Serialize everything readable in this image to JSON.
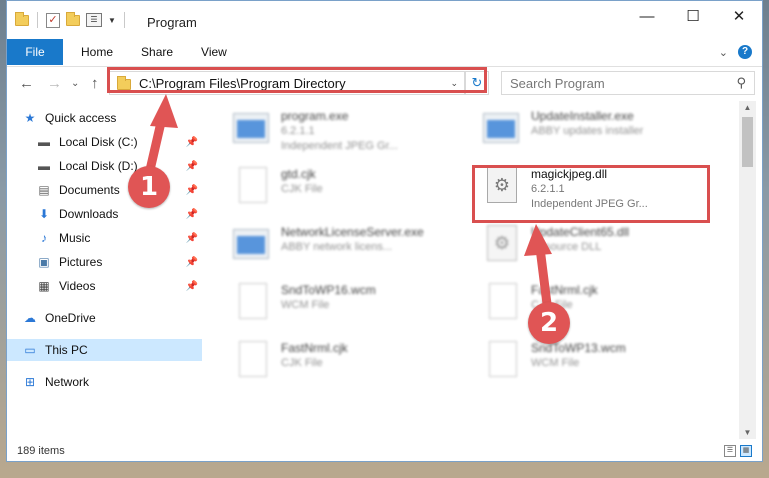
{
  "window": {
    "title": "Program",
    "controls": {
      "minimize": "—",
      "maximize": "☐",
      "close": "✕"
    }
  },
  "ribbon": {
    "file_tab": "File",
    "tabs": [
      "Home",
      "Share",
      "View"
    ]
  },
  "address": {
    "path": "C:\\Program Files\\Program Directory",
    "search_placeholder": "Search Program"
  },
  "sidebar": {
    "items": [
      {
        "label": "Quick access",
        "icon": "star-icon",
        "pinned": false
      },
      {
        "label": "Local Disk (C:)",
        "icon": "drive-icon",
        "pinned": true
      },
      {
        "label": "Local Disk (D:)",
        "icon": "drive-icon",
        "pinned": true
      },
      {
        "label": "Documents",
        "icon": "documents-icon",
        "pinned": true
      },
      {
        "label": "Downloads",
        "icon": "download-icon",
        "pinned": true
      },
      {
        "label": "Music",
        "icon": "music-icon",
        "pinned": true
      },
      {
        "label": "Pictures",
        "icon": "pictures-icon",
        "pinned": true
      },
      {
        "label": "Videos",
        "icon": "videos-icon",
        "pinned": true
      },
      {
        "label": "OneDrive",
        "icon": "cloud-icon",
        "pinned": false
      },
      {
        "label": "This PC",
        "icon": "computer-icon",
        "pinned": false,
        "selected": true
      },
      {
        "label": "Network",
        "icon": "network-icon",
        "pinned": false
      }
    ]
  },
  "files": [
    {
      "name": "program.exe",
      "line2": "6.2.1.1",
      "line3": "Independent JPEG Gr...",
      "icon": "exe",
      "blurred": true
    },
    {
      "name": "UpdateInstaller.exe",
      "line2": "ABBY updates installer",
      "line3": "",
      "icon": "exe",
      "blurred": true
    },
    {
      "name": "gtd.cjk",
      "line2": "CJK File",
      "line3": "",
      "icon": "doc",
      "blurred": true
    },
    {
      "name": "magickjpeg.dll",
      "line2": "6.2.1.1",
      "line3": "Independent JPEG Gr...",
      "icon": "gear",
      "blurred": false
    },
    {
      "name": "NetworkLicenseServer.exe",
      "line2": "ABBY network licens...",
      "line3": "",
      "icon": "exe",
      "blurred": true
    },
    {
      "name": "UpdateClient65.dll",
      "line2": "Resource DLL",
      "line3": "",
      "icon": "gear",
      "blurred": true
    },
    {
      "name": "SndToWP16.wcm",
      "line2": "WCM File",
      "line3": "",
      "icon": "doc",
      "blurred": true
    },
    {
      "name": "FastNrml.cjk",
      "line2": "CJK File",
      "line3": "",
      "icon": "doc",
      "blurred": true
    },
    {
      "name": "FastNrml.cjk",
      "line2": "CJK File",
      "line3": "",
      "icon": "doc",
      "blurred": true
    },
    {
      "name": "SndToWP13.wcm",
      "line2": "WCM File",
      "line3": "",
      "icon": "doc",
      "blurred": true
    }
  ],
  "status": {
    "item_count": "189 items"
  },
  "annotations": {
    "step1": "1",
    "step2": "2",
    "color": "#e05555"
  }
}
